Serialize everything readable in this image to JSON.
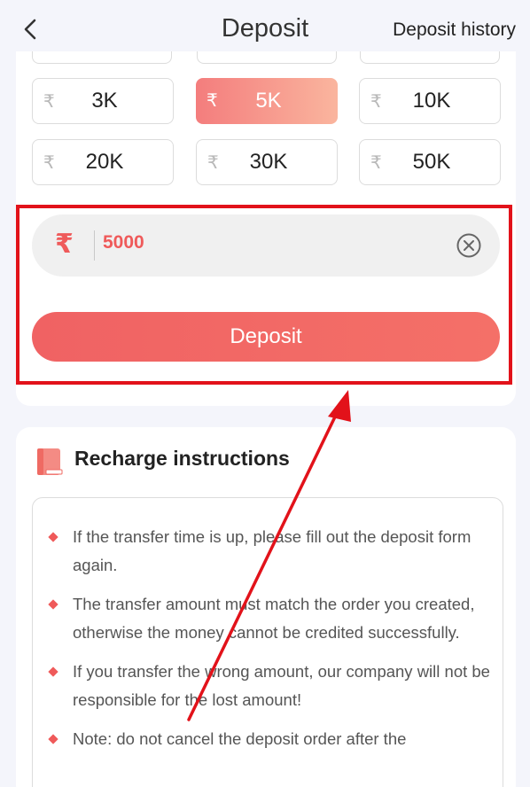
{
  "header": {
    "title": "Deposit",
    "history_label": "Deposit history"
  },
  "amount_options": [
    {
      "currency": "₹",
      "label": "3K",
      "selected": false
    },
    {
      "currency": "₹",
      "label": "5K",
      "selected": true
    },
    {
      "currency": "₹",
      "label": "10K",
      "selected": false
    },
    {
      "currency": "₹",
      "label": "20K",
      "selected": false
    },
    {
      "currency": "₹",
      "label": "30K",
      "selected": false
    },
    {
      "currency": "₹",
      "label": "50K",
      "selected": false
    }
  ],
  "amount_input": {
    "currency": "₹",
    "value": "5000"
  },
  "deposit_button_label": "Deposit",
  "instructions": {
    "title": "Recharge instructions",
    "items": [
      "If the transfer time is up, please fill out the deposit form again.",
      "The transfer amount must match the order you created, otherwise the money cannot be credited successfully.",
      "If you transfer the wrong amount, our company will not be responsible for the lost amount!",
      "Note: do not cancel the deposit order after the"
    ]
  },
  "colors": {
    "accent": "#ef5a5a",
    "annotation": "#e2121a"
  },
  "icons": {
    "back": "chevron-left-icon",
    "clear": "clear-icon",
    "book": "book-icon",
    "rupee": "rupee-icon"
  }
}
